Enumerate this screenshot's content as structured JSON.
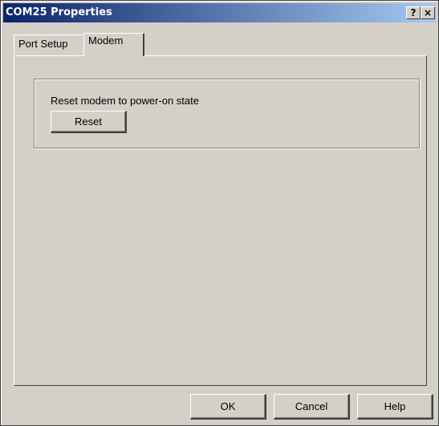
{
  "window": {
    "title": "COM25 Properties",
    "help_button": "?",
    "close_button": "×"
  },
  "tabs": [
    {
      "label": "Port Setup",
      "active": false
    },
    {
      "label": "Modem",
      "active": true
    }
  ],
  "modem_tab": {
    "reset_label": "Reset modem to power-on state",
    "reset_button": "Reset"
  },
  "footer": {
    "ok": "OK",
    "cancel": "Cancel",
    "help": "Help"
  }
}
